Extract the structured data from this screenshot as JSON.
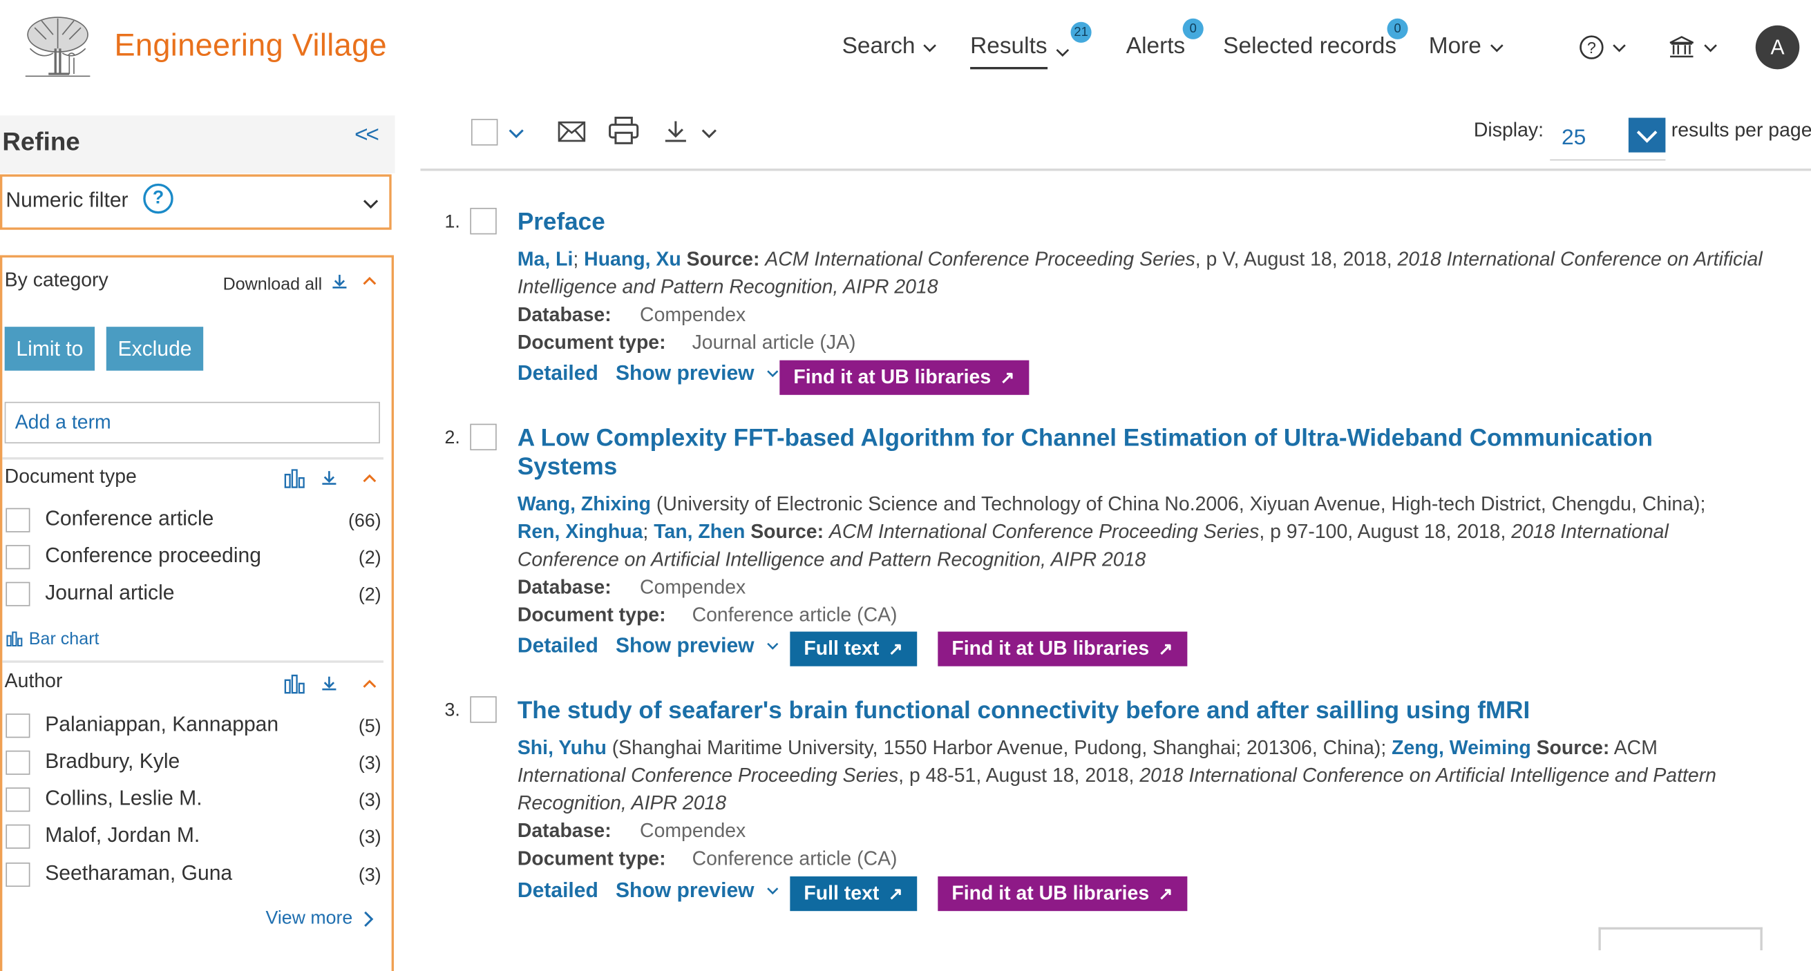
{
  "header": {
    "brand": "Engineering Village",
    "nav": [
      {
        "label": "Search",
        "badge": null
      },
      {
        "label": "Results",
        "badge": "21"
      },
      {
        "label": "Alerts",
        "badge": "0"
      },
      {
        "label": "Selected records",
        "badge": "0"
      },
      {
        "label": "More",
        "badge": null
      }
    ],
    "help_icon": "question-circle-icon",
    "institution_icon": "institution-icon",
    "avatar_initial": "A"
  },
  "sidebar": {
    "title": "Refine",
    "collapse_label": "<<",
    "numeric_filter": "Numeric filter",
    "by_category": "By category",
    "download_all": "Download all",
    "limit_to": "Limit to",
    "exclude": "Exclude",
    "add_term_placeholder": "Add a term",
    "document_type": {
      "title": "Document type",
      "items": [
        {
          "label": "Conference article",
          "count": "(66)"
        },
        {
          "label": "Conference proceeding",
          "count": "(2)"
        },
        {
          "label": "Journal article",
          "count": "(2)"
        }
      ],
      "bar_chart": "Bar chart"
    },
    "author": {
      "title": "Author",
      "items": [
        {
          "label": "Palaniappan, Kannappan",
          "count": "(5)"
        },
        {
          "label": "Bradbury, Kyle",
          "count": "(3)"
        },
        {
          "label": "Collins, Leslie M.",
          "count": "(3)"
        },
        {
          "label": "Malof, Jordan M.",
          "count": "(3)"
        },
        {
          "label": "Seetharaman, Guna",
          "count": "(3)"
        }
      ],
      "view_more": "View more"
    }
  },
  "toolbar": {
    "display_label": "Display:",
    "display_value": "25",
    "results_per_page": "results per page"
  },
  "results": [
    {
      "num": "1.",
      "title": "Preface",
      "authors_line1": [
        {
          "type": "author",
          "text": "Ma, Li"
        },
        {
          "type": "plain",
          "text": "; "
        },
        {
          "type": "author",
          "text": "Huang, Xu"
        },
        {
          "type": "plain",
          "text": " "
        },
        {
          "type": "label",
          "text": "Source:"
        },
        {
          "type": "plain",
          "text": " "
        },
        {
          "type": "italic",
          "text": "ACM International Conference Proceeding Series"
        },
        {
          "type": "plain",
          "text": ", p V, August 18, 2018, "
        },
        {
          "type": "italic",
          "text": "2018 International Conference on Artificial"
        }
      ],
      "authors_line2": [
        {
          "type": "italic",
          "text": "Intelligence and Pattern Recognition, AIPR 2018"
        }
      ],
      "database_label": "Database:",
      "database": "Compendex",
      "doctype_label": "Document type:",
      "doctype": "Journal article (JA)",
      "detailed": "Detailed",
      "show_preview": "Show preview",
      "full_text": null,
      "find_it": "Find it at UB libraries"
    },
    {
      "num": "2.",
      "title": "A Low Complexity FFT-based Algorithm for Channel Estimation of Ultra-Wideband Communication Systems",
      "authors_line1": [
        {
          "type": "author",
          "text": "Wang, Zhixing"
        },
        {
          "type": "plain",
          "text": " (University of Electronic Science and Technology of China No.2006, Xiyuan Avenue, High-tech District, Chengdu, China);"
        }
      ],
      "authors_line2": [
        {
          "type": "author",
          "text": "Ren, Xinghua"
        },
        {
          "type": "plain",
          "text": "; "
        },
        {
          "type": "author",
          "text": "Tan, Zhen"
        },
        {
          "type": "plain",
          "text": " "
        },
        {
          "type": "label",
          "text": "Source:"
        },
        {
          "type": "plain",
          "text": " "
        },
        {
          "type": "italic",
          "text": "ACM International Conference Proceeding Series"
        },
        {
          "type": "plain",
          "text": ", p 97-100, August 18, 2018, "
        },
        {
          "type": "italic",
          "text": "2018 International"
        }
      ],
      "authors_line3": [
        {
          "type": "italic",
          "text": "Conference on Artificial Intelligence and Pattern Recognition, AIPR 2018"
        }
      ],
      "database_label": "Database:",
      "database": "Compendex",
      "doctype_label": "Document type:",
      "doctype": "Conference article (CA)",
      "detailed": "Detailed",
      "show_preview": "Show preview",
      "full_text": "Full text",
      "find_it": "Find it at UB libraries"
    },
    {
      "num": "3.",
      "title": "The study of seafarer's brain functional connectivity before and after sailling using fMRI",
      "authors_line1": [
        {
          "type": "author",
          "text": "Shi, Yuhu"
        },
        {
          "type": "plain",
          "text": " (Shanghai Maritime University, 1550 Harbor Avenue, Pudong, Shanghai; 201306, China); "
        },
        {
          "type": "author",
          "text": "Zeng, Weiming"
        },
        {
          "type": "plain",
          "text": " "
        },
        {
          "type": "label",
          "text": "Source:"
        },
        {
          "type": "plain",
          "text": " ACM"
        }
      ],
      "authors_line2": [
        {
          "type": "italic",
          "text": "International Conference Proceeding Series"
        },
        {
          "type": "plain",
          "text": ", p 48-51, August 18, 2018, "
        },
        {
          "type": "italic",
          "text": "2018 International Conference on Artificial Intelligence and Pattern"
        }
      ],
      "authors_line3": [
        {
          "type": "italic",
          "text": "Recognition, AIPR 2018"
        }
      ],
      "database_label": "Database:",
      "database": "Compendex",
      "doctype_label": "Document type:",
      "doctype": "Conference article (CA)",
      "detailed": "Detailed",
      "show_preview": "Show preview",
      "full_text": "Full text",
      "find_it": "Find it at UB libraries"
    }
  ]
}
